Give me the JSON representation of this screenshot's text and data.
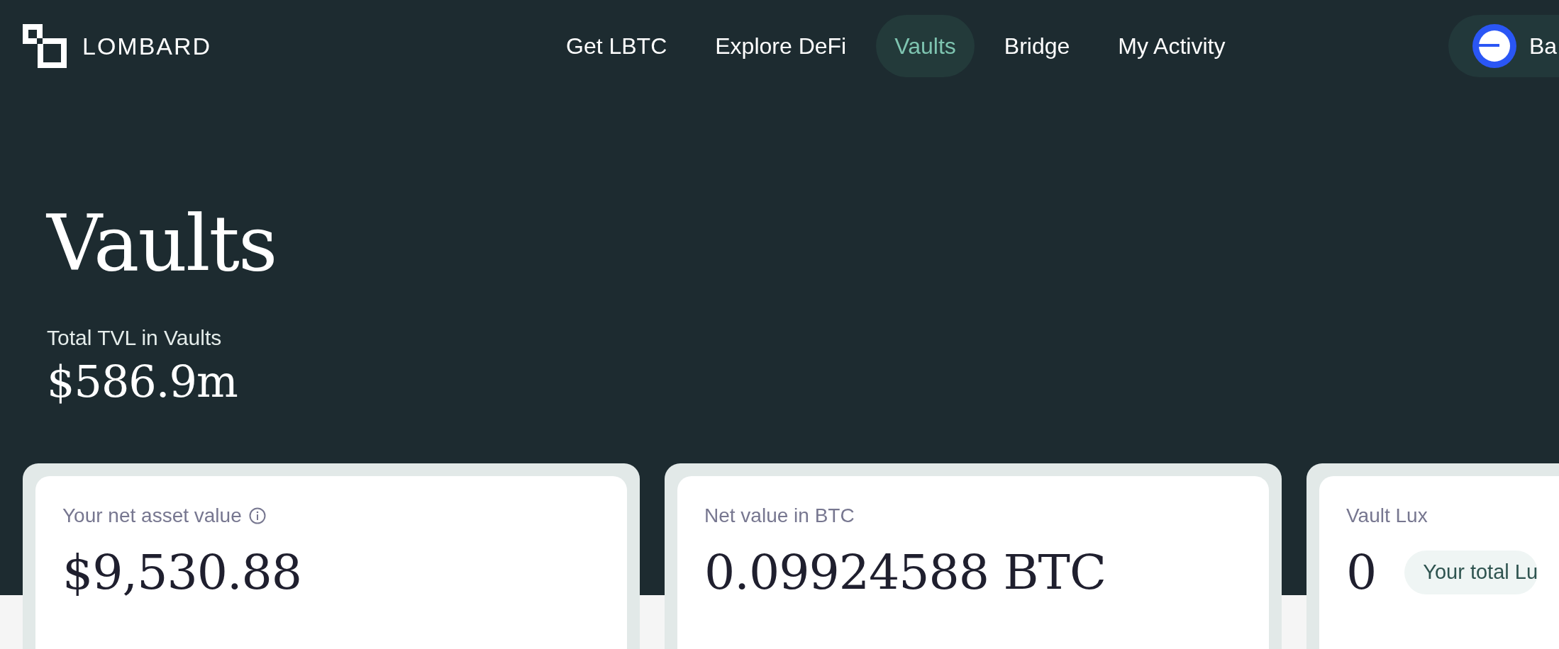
{
  "logo": {
    "text": "LOMBARD"
  },
  "nav": [
    {
      "label": "Get LBTC",
      "selected": false
    },
    {
      "label": "Explore DeFi",
      "selected": false
    },
    {
      "label": "Vaults",
      "selected": true
    },
    {
      "label": "Bridge",
      "selected": false
    },
    {
      "label": "My Activity",
      "selected": false
    }
  ],
  "wallet": {
    "label": "Ba"
  },
  "page_title": "Vaults",
  "tvl": {
    "label": "Total TVL in Vaults",
    "value": "$586.9m"
  },
  "cards": [
    {
      "kind": "info",
      "label": "Your net asset value",
      "value": "$9,530.88"
    },
    {
      "kind": "plain",
      "label": "Net value in BTC",
      "value": "0.09924588 BTC"
    },
    {
      "kind": "badge",
      "label": "Vault Lux",
      "value": "0",
      "badge": "Your total Lu"
    }
  ]
}
